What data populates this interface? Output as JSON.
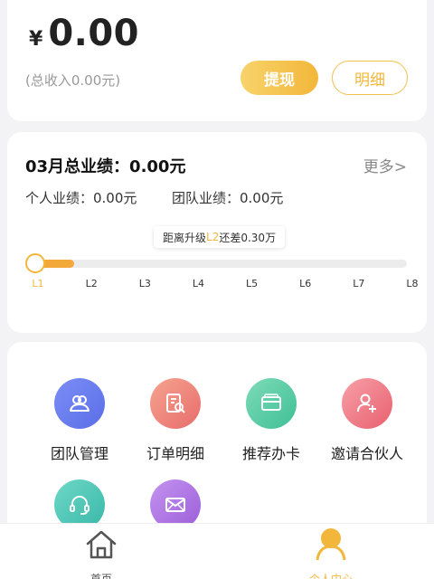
{
  "balance": {
    "currency_symbol": "¥",
    "amount": "0.00",
    "total_income": "(总收入0.00元)",
    "withdraw_label": "提现",
    "detail_label": "明细"
  },
  "performance": {
    "title": "03月总业绩：0.00元",
    "more_label": "更多>",
    "personal": "个人业绩：0.00元",
    "team": "团队业绩：0.00元",
    "tooltip_prefix": "距离升级",
    "tooltip_level": "L2",
    "tooltip_suffix": "还差0.30万",
    "progress_fraction": 0.12,
    "levels": [
      "L1",
      "L2",
      "L3",
      "L4",
      "L5",
      "L6",
      "L7",
      "L8"
    ],
    "current_level_index": 0
  },
  "menu": [
    {
      "label": "团队管理",
      "icon": "team-icon",
      "color_from": "#7b8ef5",
      "color_to": "#5a6ee8"
    },
    {
      "label": "订单明细",
      "icon": "order-search-icon",
      "color_from": "#f5a48f",
      "color_to": "#e86c6c"
    },
    {
      "label": "推荐办卡",
      "icon": "card-icon",
      "color_from": "#7ddcb8",
      "color_to": "#3fbf96"
    },
    {
      "label": "邀请合伙人",
      "icon": "add-user-icon",
      "color_from": "#f7a0a8",
      "color_to": "#e8606e"
    },
    {
      "label": "",
      "icon": "headset-icon",
      "color_from": "#6fd8c7",
      "color_to": "#38b8a8"
    },
    {
      "label": "",
      "icon": "mail-icon",
      "color_from": "#c493f0",
      "color_to": "#9b5ed8"
    }
  ],
  "tabbar": {
    "home_label": "首页",
    "profile_label": "个人中心",
    "active_color": "#f2b73a"
  }
}
